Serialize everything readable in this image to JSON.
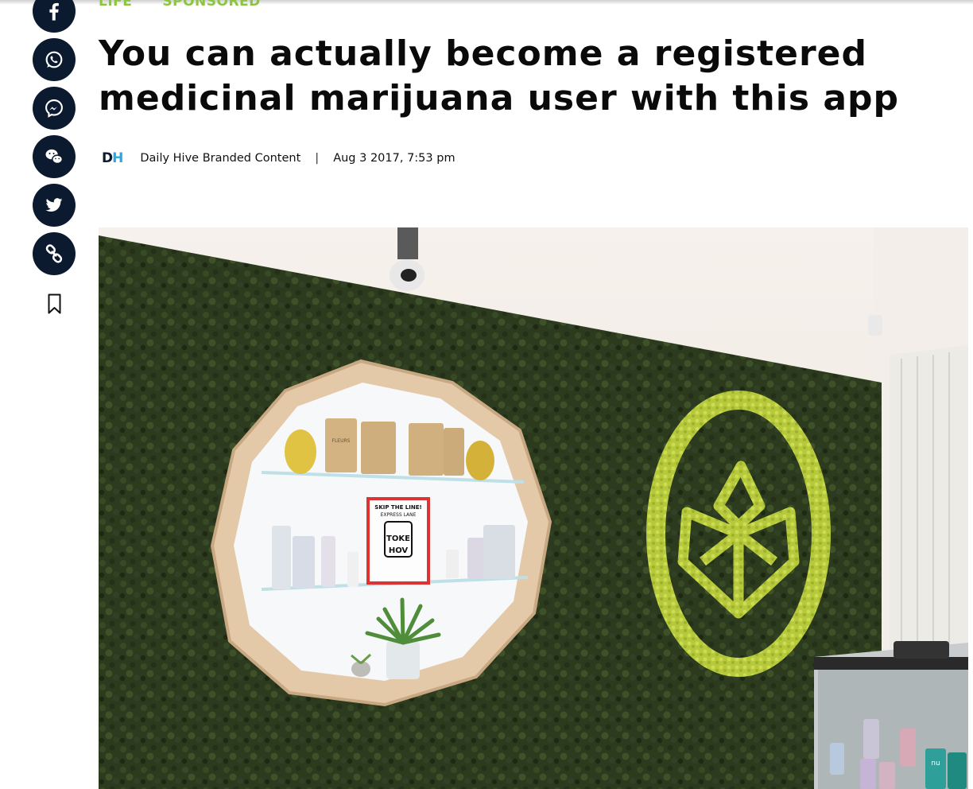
{
  "categories": [
    "LIFE",
    "SPONSORED"
  ],
  "article": {
    "title": "You can actually become a registered medicinal marijuana user with this app",
    "author": "Daily Hive Branded Content",
    "separator": "|",
    "date": "Aug 3 2017, 7:53 pm"
  },
  "author_logo": {
    "left": "D",
    "right": "H"
  },
  "share": [
    "facebook-icon",
    "whatsapp-icon",
    "messenger-icon",
    "wechat-icon",
    "twitter-icon",
    "link-icon"
  ],
  "colors": {
    "accent": "#8cc63f",
    "rail": "#0c1a2f",
    "logo_h": "#29a8e0"
  },
  "photo": {
    "sign": {
      "line1": "SKIP THE LINE!",
      "line2": "EXPRESS LANE",
      "line3": "TOKE",
      "line4": "HOV"
    },
    "bag_label": "FLEURS",
    "can_label": "nu"
  }
}
